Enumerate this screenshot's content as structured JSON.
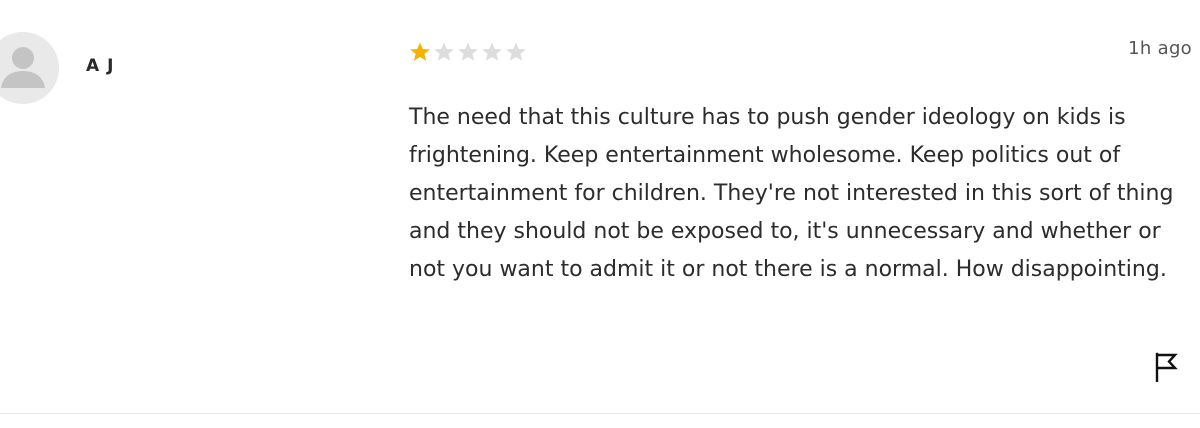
{
  "review": {
    "author": "A J",
    "rating": 1,
    "max_rating": 5,
    "time": "1h ago",
    "text": "The need that this culture has to push gender ideology on kids is frightening. Keep entertainment wholesome. Keep politics out of entertainment for children. They're not interested in this sort of thing and they should not be exposed to, it's unnecessary and whether or not you want to admit it or not there is a normal. How disappointing."
  },
  "icons": {
    "avatar": "user-avatar-placeholder",
    "star": "star-icon",
    "flag": "flag-icon"
  },
  "colors": {
    "star_filled": "#f5b301",
    "star_empty": "#dddddd",
    "avatar_bg": "#e9e9e9",
    "avatar_fg": "#c4c4c4"
  }
}
